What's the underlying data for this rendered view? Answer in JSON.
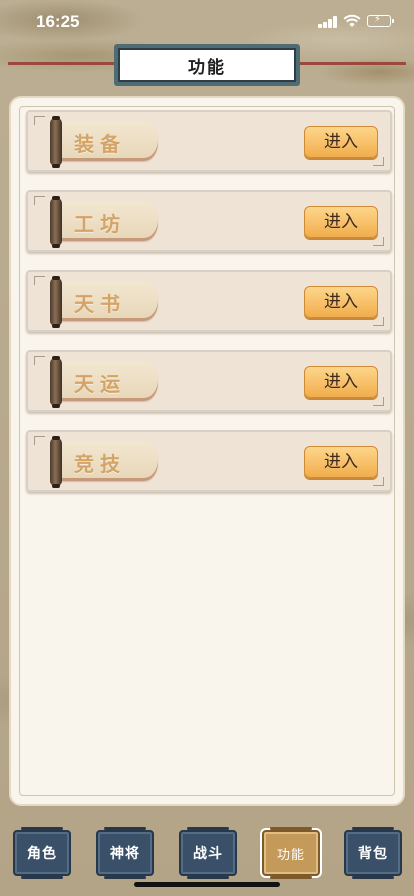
{
  "status_bar": {
    "time": "16:25"
  },
  "header": {
    "title": "功能"
  },
  "functions": [
    {
      "label": "装备",
      "button": "进入"
    },
    {
      "label": "工坊",
      "button": "进入"
    },
    {
      "label": "天书",
      "button": "进入"
    },
    {
      "label": "天运",
      "button": "进入"
    },
    {
      "label": "竞技",
      "button": "进入"
    }
  ],
  "tabbar": {
    "tabs": [
      {
        "label": "角色"
      },
      {
        "label": "神将"
      },
      {
        "label": "战斗"
      },
      {
        "label": "功能",
        "active": true
      },
      {
        "label": "背包"
      }
    ]
  },
  "colors": {
    "accent_button": "#f1ad4e",
    "tab_default": "#3a5068",
    "tab_active": "#c49a5a",
    "panel_bg": "#faf5ec"
  }
}
